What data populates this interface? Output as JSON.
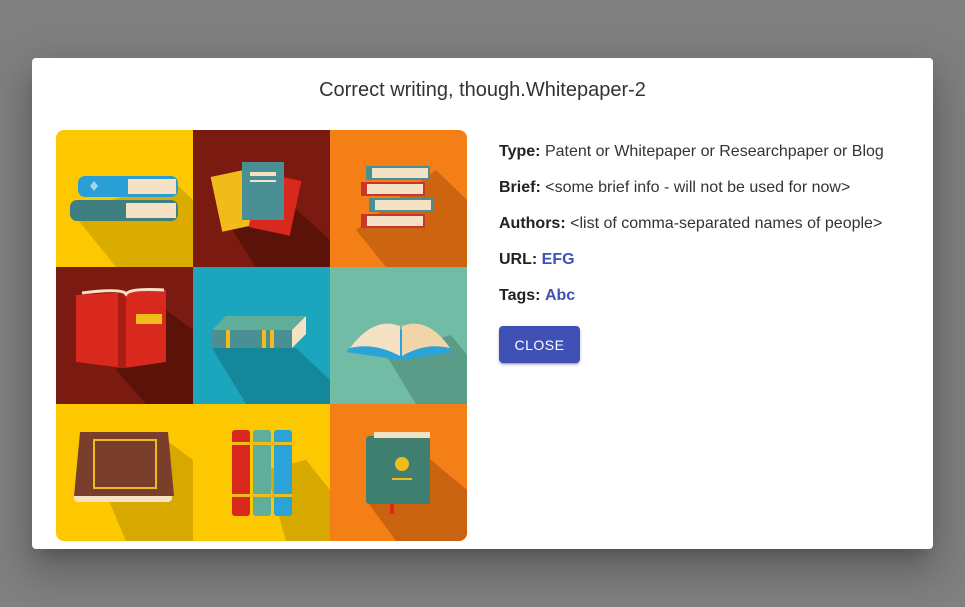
{
  "dialog": {
    "title": "Correct writing, though.Whitepaper-2",
    "image_icon": "books-collage-icon",
    "fields": {
      "type_label": "Type:",
      "type_value": "Patent or Whitepaper or Researchpaper or Blog",
      "brief_label": "Brief:",
      "brief_value": "<some brief info - will not be used for now>",
      "authors_label": "Authors:",
      "authors_value": "<list of comma-separated names of people>",
      "url_label": "URL:",
      "url_value": "EFG",
      "tags_label": "Tags:",
      "tags_value": "Abc"
    },
    "close_label": "Close"
  },
  "colors": {
    "accent": "#3f51b5",
    "backdrop": "#808080",
    "tile_yellow": "#fdc800",
    "tile_maroon": "#7b1a10",
    "tile_orange": "#f57f17",
    "tile_teal": "#1ca6be",
    "tile_mint": "#72bba4"
  }
}
